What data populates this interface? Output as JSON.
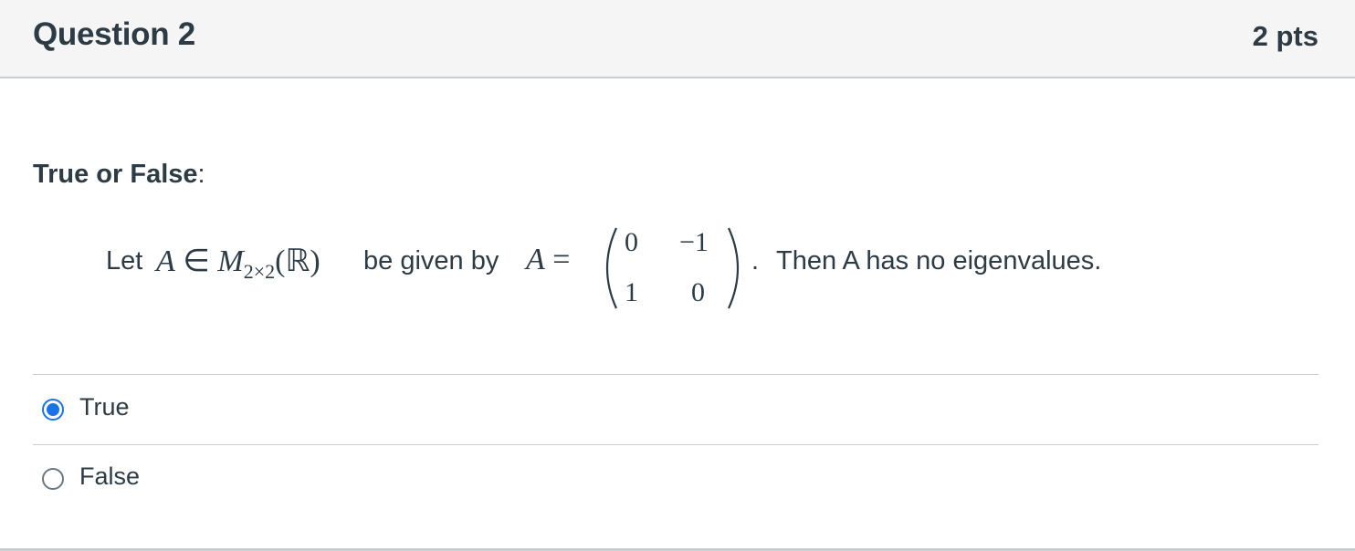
{
  "question": {
    "title": "Question 2",
    "points": "2 pts",
    "heading_bold": "True or False",
    "heading_colon": ":",
    "statement": {
      "let": "Let",
      "set_expr_A": "A",
      "set_expr_in": "∈",
      "set_expr_M": "M",
      "set_expr_sub": "2×2",
      "set_expr_field": "(ℝ)",
      "be_given_by": "be given by",
      "eq_A": "A",
      "eq_sign": "=",
      "matrix": [
        "0",
        "−1",
        "1",
        "0"
      ],
      "period": ".",
      "conclusion": "Then A has no eigenvalues."
    }
  },
  "options": [
    {
      "label": "True",
      "selected": true
    },
    {
      "label": "False",
      "selected": false
    }
  ],
  "colors": {
    "selected_radio": "#1a73e8",
    "text": "#2d3b45",
    "header_bg": "#f5f5f5"
  }
}
